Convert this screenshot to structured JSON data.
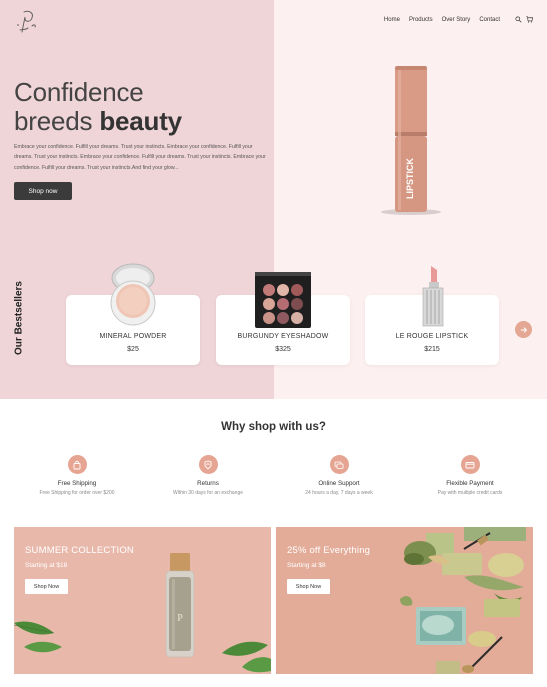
{
  "nav": {
    "items": [
      "Home",
      "Products",
      "Over Story",
      "Contact"
    ]
  },
  "icons": {
    "logo": "script-p-logo",
    "search": "search-icon",
    "cart": "cart-icon",
    "next": "arrow-right-icon"
  },
  "hero": {
    "title_line1": "Confidence",
    "title_line2_prefix": "breeds ",
    "title_line2_bold": "beauty",
    "description": "Embrace your confidence. Fulfill your dreams. Trust your instincts. Embrace your confidence. Fulfill your dreams. Trust your instincts. Embrace your confidence. Fulfill your dreams. Trust your instincts. Embrace your confidence. Fulfill your dreams. Trust your instincts.And find your glow...",
    "cta": "Shop now",
    "product_text": "LIPSTICK"
  },
  "bestsellers": {
    "label": "Our Bestsellers",
    "items": [
      {
        "name": "MINERAL POWDER",
        "price": "$25"
      },
      {
        "name": "BURGUNDY EYESHADOW",
        "price": "$325"
      },
      {
        "name": "LE ROUGE LIPSTICK",
        "price": "$215"
      }
    ]
  },
  "why": {
    "title": "Why shop with us?",
    "features": [
      {
        "title": "Free Shipping",
        "subtitle": "Free Shipping for order over $200",
        "icon": "bag-icon"
      },
      {
        "title": "Returns",
        "subtitle": "Within 30 days for an exchange",
        "icon": "return-icon"
      },
      {
        "title": "Online Support",
        "subtitle": "24 hours a day, 7 days a week",
        "icon": "chat-icon"
      },
      {
        "title": "Flexible Payment",
        "subtitle": "Pay with multiple credit cards",
        "icon": "card-icon"
      }
    ]
  },
  "promos": [
    {
      "title": "SUMMER COLLECTION",
      "subtitle": "Starting at $18",
      "cta": "Shop Now"
    },
    {
      "title": "25% off Everything",
      "subtitle": "Starting at $8",
      "cta": "Shop Now"
    }
  ],
  "colors": {
    "hero_left": "#f0d5d8",
    "hero_right": "#fdf0f0",
    "accent": "#e6a593",
    "dark_button": "#3b3b3b",
    "promo_left": "#e8b9ab",
    "promo_right": "#e3ac99"
  }
}
